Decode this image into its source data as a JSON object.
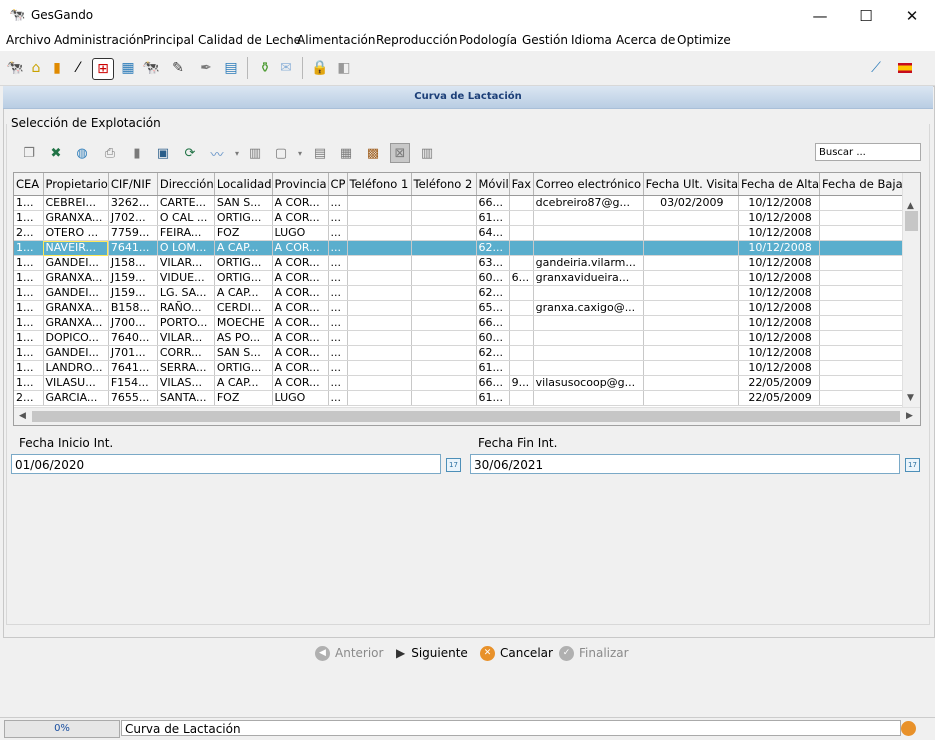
{
  "window": {
    "title": "GesGando",
    "app_icon": "cow-icon",
    "minimize": "—",
    "maximize": "☐",
    "close": "✕"
  },
  "menu": [
    "Archivo",
    "Administración",
    "Principal",
    "Calidad de Leche",
    "Alimentación",
    "Reproducción",
    "Podología",
    "Gestión",
    "Idioma",
    "Acerca de",
    "Optimize"
  ],
  "panel": {
    "title": "Curva de Lactación",
    "section_label": "Selección de Explotación",
    "search_placeholder": "Buscar ..."
  },
  "table": {
    "columns": [
      "CEA",
      "Propietario",
      "CIF/NIF",
      "Dirección",
      "Localidad",
      "Provincia",
      "CP",
      "Teléfono 1",
      "Teléfono 2",
      "Móvil",
      "Fax",
      "Correo electrónico",
      "Fecha Ult. Visita",
      "Fecha de Alta",
      "Fecha de Baja"
    ],
    "selected_index": 3,
    "rows": [
      [
        "1...",
        "CEBREI...",
        "3262...",
        "CARTE...",
        "SAN S...",
        "A COR...",
        "...",
        "",
        "",
        "66...",
        "",
        "dcebreiro87@g...",
        "03/02/2009",
        "10/12/2008",
        ""
      ],
      [
        "1...",
        "GRANXA...",
        "J702...",
        "O CAL ...",
        "ORTIG...",
        "A COR...",
        "...",
        "",
        "",
        "61...",
        "",
        "",
        "",
        "10/12/2008",
        ""
      ],
      [
        "2...",
        "OTERO ...",
        "7759...",
        "FEIRA...",
        "FOZ",
        "LUGO",
        "...",
        "",
        "",
        "64...",
        "",
        "",
        "",
        "10/12/2008",
        ""
      ],
      [
        "1...",
        "NAVEIR...",
        "7641...",
        "O LOM...",
        "A CAP...",
        "A COR...",
        "...",
        "",
        "",
        "62...",
        "",
        "",
        "",
        "10/12/2008",
        ""
      ],
      [
        "1...",
        "GANDEI...",
        "J158...",
        "VILAR...",
        "ORTIG...",
        "A COR...",
        "...",
        "",
        "",
        "63...",
        "",
        "gandeiria.vilarm...",
        "",
        "10/12/2008",
        ""
      ],
      [
        "1...",
        "GRANXA...",
        "J159...",
        "VIDUE...",
        "ORTIG...",
        "A COR...",
        "...",
        "",
        "",
        "60...",
        "6...",
        "granxavidueira...",
        "",
        "10/12/2008",
        ""
      ],
      [
        "1...",
        "GANDEI...",
        "J159...",
        "LG. SA...",
        "A CAP...",
        "A COR...",
        "...",
        "",
        "",
        "62...",
        "",
        "",
        "",
        "10/12/2008",
        ""
      ],
      [
        "1...",
        "GRANXA...",
        "B158...",
        "RAÑO...",
        "CERDI...",
        "A COR...",
        "...",
        "",
        "",
        "65...",
        "",
        "granxa.caxigo@...",
        "",
        "10/12/2008",
        ""
      ],
      [
        "1...",
        "GRANXA...",
        "J700...",
        "PORTO...",
        "MOECHE",
        "A COR...",
        "...",
        "",
        "",
        "66...",
        "",
        "",
        "",
        "10/12/2008",
        ""
      ],
      [
        "1...",
        "DOPICO...",
        "7640...",
        "VILAR...",
        "AS PO...",
        "A COR...",
        "...",
        "",
        "",
        "60...",
        "",
        "",
        "",
        "10/12/2008",
        ""
      ],
      [
        "1...",
        "GANDEI...",
        "J701...",
        "CORR...",
        "SAN S...",
        "A COR...",
        "...",
        "",
        "",
        "62...",
        "",
        "",
        "",
        "10/12/2008",
        ""
      ],
      [
        "1...",
        "LANDRO...",
        "7641...",
        "SERRA...",
        "ORTIG...",
        "A COR...",
        "...",
        "",
        "",
        "61...",
        "",
        "",
        "",
        "10/12/2008",
        ""
      ],
      [
        "1...",
        "VILASU...",
        "F154...",
        "VILAS...",
        "A CAP...",
        "A COR...",
        "...",
        "",
        "",
        "66...",
        "9...",
        "vilasusocoop@g...",
        "",
        "22/05/2009",
        ""
      ],
      [
        "2...",
        "GARCIA...",
        "7655...",
        "SANTA...",
        "FOZ",
        "LUGO",
        "...",
        "",
        "",
        "61...",
        "",
        "",
        "",
        "22/05/2009",
        ""
      ]
    ]
  },
  "dates": {
    "start_label": "Fecha Inicio Int.",
    "start_value": "01/06/2020",
    "end_label": "Fecha Fin Int.",
    "end_value": "30/06/2021"
  },
  "nav": {
    "prev": "Anterior",
    "next": "Siguiente",
    "cancel": "Cancelar",
    "finish": "Finalizar"
  },
  "status": {
    "progress": "0%",
    "message": "Curva de Lactación"
  }
}
